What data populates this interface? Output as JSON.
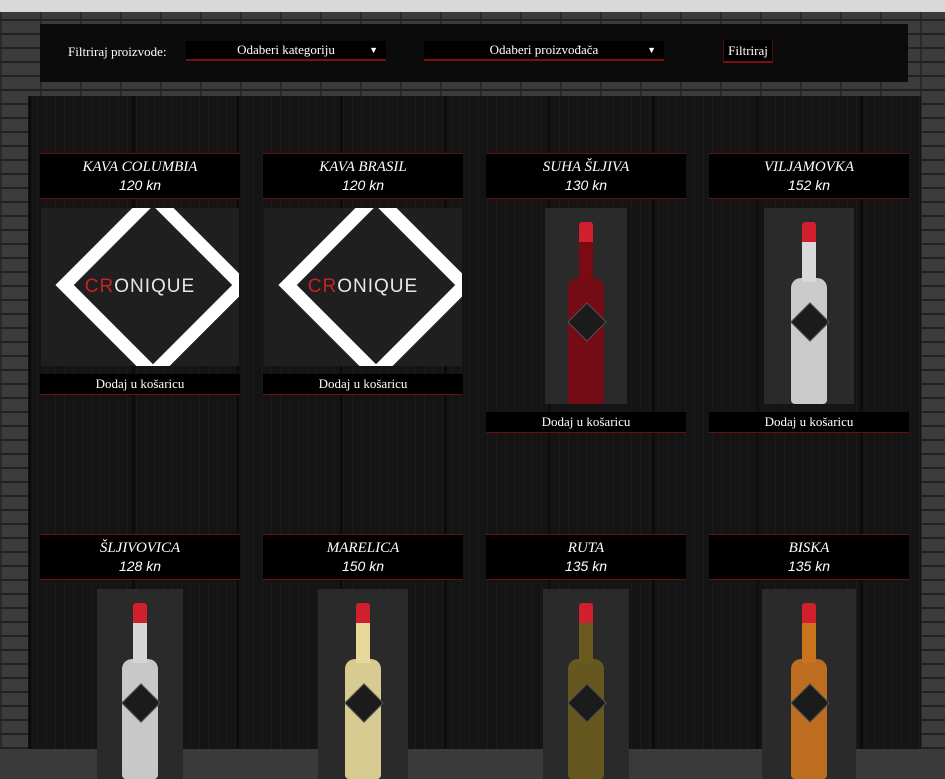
{
  "filter": {
    "label": "Filtriraj proizvode:",
    "category_select": "Odaberi kategoriju",
    "producer_select": "Odaberi proizvođača",
    "button": "Filtriraj"
  },
  "products": [
    {
      "name": "KAVA COLUMBIA",
      "price": "120 kn",
      "cart": "Dodaj u košaricu",
      "image": "logo",
      "logo_text": "CRONIQUE"
    },
    {
      "name": "KAVA BRASIL",
      "price": "120 kn",
      "cart": "Dodaj u košaricu",
      "image": "logo",
      "logo_text": "CRONIQUE"
    },
    {
      "name": "SUHA ŠLJIVA",
      "price": "130 kn",
      "cart": "Dodaj u košaricu",
      "image": "bottle",
      "liquid": "#7a0a14"
    },
    {
      "name": "VILJAMOVKA",
      "price": "152 kn",
      "cart": "Dodaj u košaricu",
      "image": "bottle",
      "liquid": "#d9d9d9"
    },
    {
      "name": "ŠLJIVOVICA",
      "price": "128 kn",
      "cart": "",
      "image": "bottle",
      "liquid": "#d6d6d6"
    },
    {
      "name": "MARELICA",
      "price": "150 kn",
      "cart": "",
      "image": "bottle",
      "liquid": "#e6d99a"
    },
    {
      "name": "RUTA",
      "price": "135 kn",
      "cart": "",
      "image": "bottle",
      "liquid": "#6b5a1e"
    },
    {
      "name": "BISKA",
      "price": "135 kn",
      "cart": "",
      "image": "bottle",
      "liquid": "#c9731f"
    }
  ],
  "colors": {
    "accent": "#6a0e0e",
    "cap": "#d0202e"
  }
}
